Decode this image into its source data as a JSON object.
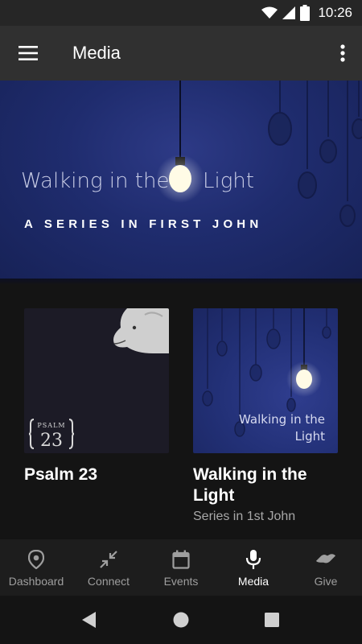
{
  "status_bar": {
    "time": "10:26"
  },
  "app_bar": {
    "title": "Media"
  },
  "hero": {
    "title_part1": "Walking in the",
    "title_part2": "Light",
    "subtitle": "A SERIES IN FIRST JOHN"
  },
  "cards": [
    {
      "title": "Psalm 23",
      "subtitle": "",
      "logo_text": "PSALM 23"
    },
    {
      "title": "Walking in the Light",
      "subtitle": "Series in 1st John",
      "thumb_line1": "Walking in the",
      "thumb_line2": "Light"
    }
  ],
  "bottom_nav": {
    "items": [
      {
        "label": "Dashboard",
        "icon": "location-pin-icon"
      },
      {
        "label": "Connect",
        "icon": "compress-arrows-icon"
      },
      {
        "label": "Events",
        "icon": "calendar-icon"
      },
      {
        "label": "Media",
        "icon": "microphone-icon",
        "active": true
      },
      {
        "label": "Give",
        "icon": "handshake-icon"
      }
    ]
  },
  "colors": {
    "app_bar": "#303030",
    "status_bar": "#262626",
    "background": "#141414",
    "hero_blue": "#1f2c6e",
    "active_nav": "#ffffff",
    "inactive_nav": "#9e9e9e"
  }
}
